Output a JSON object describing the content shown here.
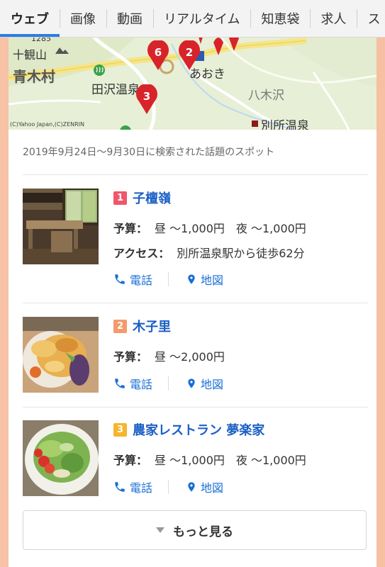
{
  "tabs": [
    {
      "label": "ウェブ",
      "active": true
    },
    {
      "label": "画像"
    },
    {
      "label": "動画"
    },
    {
      "label": "リアルタイム"
    },
    {
      "label": "知恵袋"
    },
    {
      "label": "求人"
    },
    {
      "label": "ス"
    }
  ],
  "map": {
    "labels": {
      "elevation": "1285",
      "mountain": "十観山",
      "village": "青木村",
      "onsen1": "田沢温泉",
      "aoki": "あおき",
      "yagisawa": "八木沢",
      "bessho": "別所温泉",
      "credit": "(C)Yahoo Japan,(C)ZENRIN"
    },
    "pins": [
      "6",
      "2",
      "3"
    ]
  },
  "caption": "2019年9月24日〜9月30日に検索された話題のスポット",
  "spots": [
    {
      "rank": "1",
      "rank_color": "#f0576a",
      "name": "子檀嶺",
      "budget_key": "予算：",
      "budget": "昼 〜1,000円　夜 〜1,000円",
      "access_key": "アクセス：",
      "access": "別所温泉駅から徒歩62分",
      "phone": "電話",
      "map": "地図"
    },
    {
      "rank": "2",
      "rank_color": "#f59a6a",
      "name": "木子里",
      "budget_key": "予算：",
      "budget": "昼 〜2,000円",
      "phone": "電話",
      "map": "地図"
    },
    {
      "rank": "3",
      "rank_color": "#f5b52e",
      "name": "農家レストラン 夢楽家",
      "budget_key": "予算：",
      "budget": "昼 〜1,000円　夜 〜1,000円",
      "phone": "電話",
      "map": "地図"
    }
  ],
  "more_label": "もっと見る",
  "colors": {
    "link": "#1a5fc4",
    "tab_accent": "#2b7de1",
    "pin": "#d8232a"
  }
}
